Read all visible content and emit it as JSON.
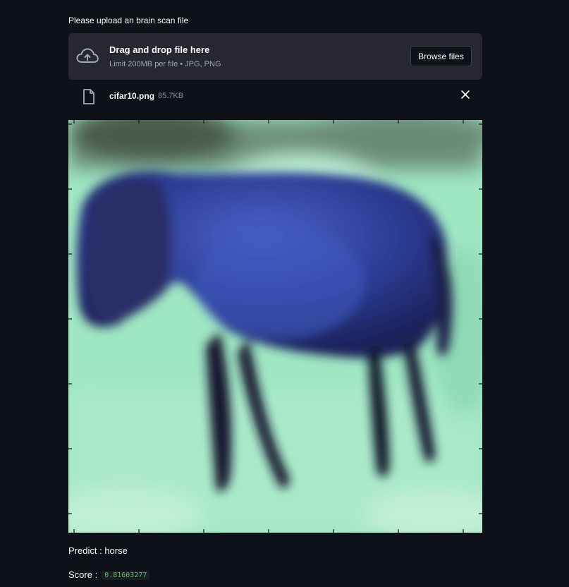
{
  "uploader": {
    "label": "Please upload an brain scan file",
    "drop_title": "Drag and drop file here",
    "drop_sub": "Limit 200MB per file • JPG, PNG",
    "browse_label": "Browse files",
    "upload_icon": "cloud-upload-icon"
  },
  "file": {
    "name": "cifar10.png",
    "size": "85.7KB",
    "file_icon": "file-icon",
    "remove_icon": "close-icon"
  },
  "result": {
    "predict_label": "Predict :",
    "predict_value": "horse",
    "score_label": "Score :",
    "score_value": "0.81603277"
  },
  "colors": {
    "background": "#0e1117",
    "dropzone": "#262730",
    "score_text": "#4fbf63"
  }
}
